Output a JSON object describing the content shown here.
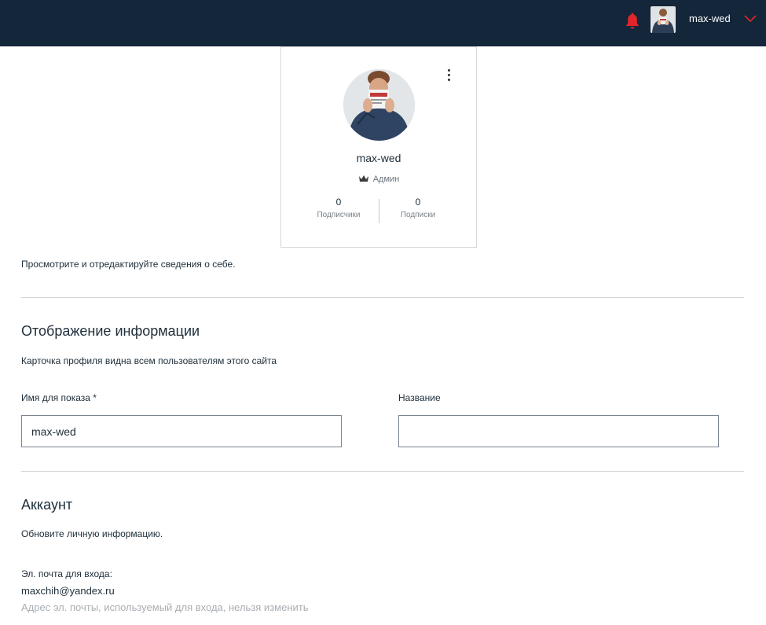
{
  "header": {
    "user_name": "max-wed",
    "bell_icon": "bell-icon",
    "bell_color": "#e0262b",
    "chevron_icon": "chevron-down-icon",
    "chevron_color": "#e0262b",
    "bg_color": "#13263a"
  },
  "profile_card": {
    "name": "max-wed",
    "role": "Админ",
    "role_icon": "crown-icon",
    "menu_icon": "more-vertical-icon",
    "followers": {
      "count": "0",
      "label": "Подписчики"
    },
    "following": {
      "count": "0",
      "label": "Подписки"
    }
  },
  "intro": "Просмотрите и отредактируйте сведения о себе.",
  "display_section": {
    "title": "Отображение информации",
    "description": "Карточка профиля видна всем пользователям этого сайта",
    "display_name_label": "Имя для показа *",
    "display_name_value": "max-wed",
    "title_label": "Название",
    "title_value": ""
  },
  "account_section": {
    "title": "Аккаунт",
    "description": "Обновите личную информацию.",
    "email_label": "Эл. почта для входа:",
    "email_value": "maxchih@yandex.ru",
    "email_hint": "Адрес эл. почты, используемый для входа, нельзя изменить"
  }
}
